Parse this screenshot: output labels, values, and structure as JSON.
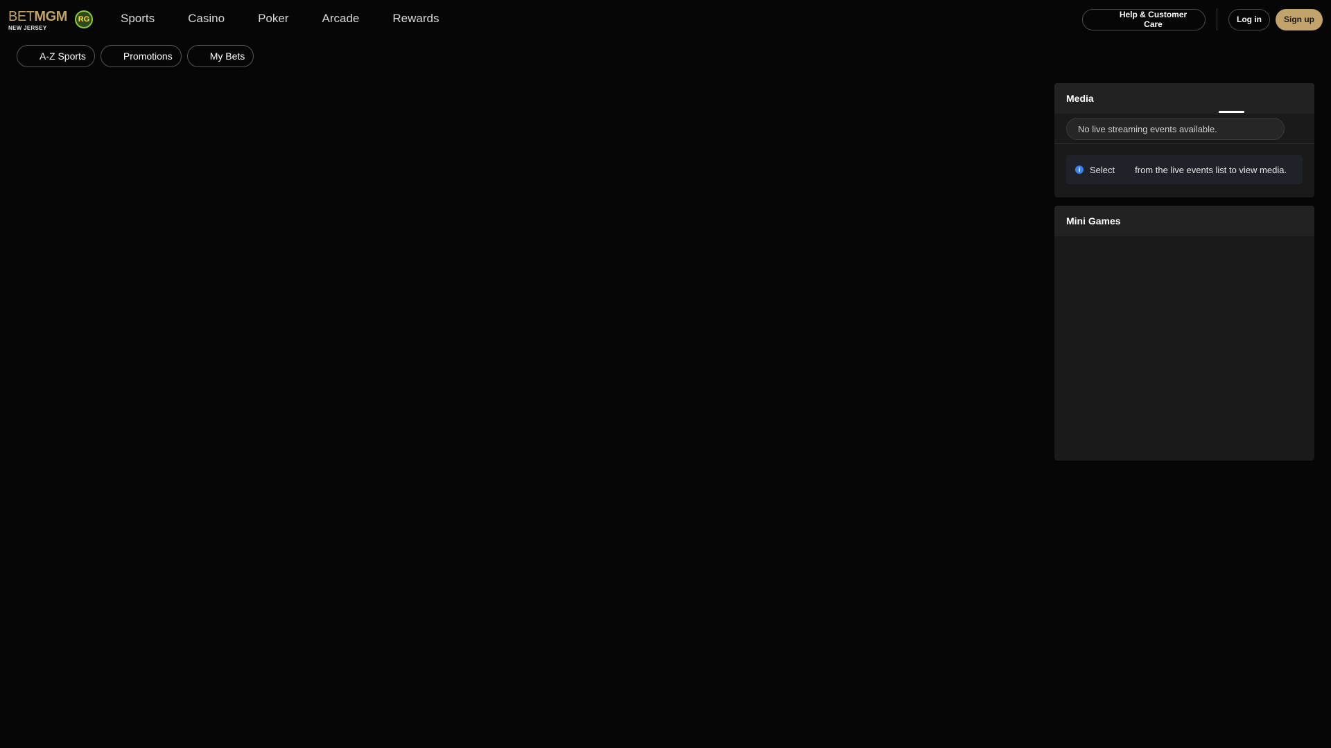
{
  "brand": {
    "name_part1": "BET",
    "name_part2": "MGM",
    "region": "NEW JERSEY",
    "rg_badge": "RG",
    "accent_color": "#c2a36b"
  },
  "main_nav": {
    "items": [
      {
        "label": "Sports"
      },
      {
        "label": "Casino"
      },
      {
        "label": "Poker"
      },
      {
        "label": "Arcade"
      },
      {
        "label": "Rewards"
      }
    ]
  },
  "header_actions": {
    "help_label": "Help & Customer Care",
    "help_icon": "chat-icon",
    "login_label": "Log in",
    "signup_label": "Sign up"
  },
  "subnav": {
    "items": [
      {
        "label": "A-Z Sports",
        "icon": "az-icon"
      },
      {
        "label": "Promotions",
        "icon": "gift-icon"
      },
      {
        "label": "My Bets",
        "icon": "bets-icon"
      }
    ]
  },
  "media_panel": {
    "title": "Media",
    "stream_selector": "No live streaming events available.",
    "info_icon": "info-icon",
    "info_part1": "Select",
    "info_part2": "from the live events list to view media."
  },
  "mini_games_panel": {
    "title": "Mini Games"
  }
}
